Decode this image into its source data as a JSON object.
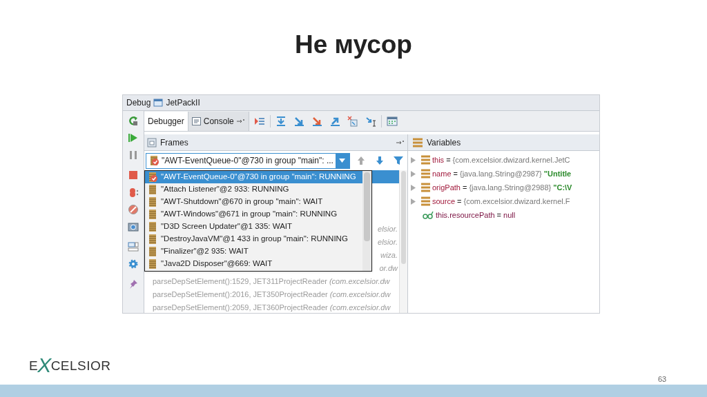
{
  "slide": {
    "title": "Не мусор",
    "logo": "EXCELSIOR",
    "page_number": "63"
  },
  "window": {
    "title": "Debug",
    "config": "JetPackII"
  },
  "tabs": [
    {
      "label": "Debugger",
      "selected": true
    },
    {
      "label": "Console",
      "selected": false
    }
  ],
  "frames": {
    "title": "Frames",
    "thread_selector": {
      "value": "\"AWT-EventQueue-0\"@730 in group \"main\": ..."
    },
    "thread_list": [
      {
        "label": "\"AWT-EventQueue-0\"@730 in group \"main\": RUNNING",
        "selected": true,
        "kind": "current"
      },
      {
        "label": "\"Attach Listener\"@2 933: RUNNING",
        "selected": false,
        "kind": "thread"
      },
      {
        "label": "\"AWT-Shutdown\"@670 in group \"main\": WAIT",
        "selected": false,
        "kind": "thread"
      },
      {
        "label": "\"AWT-Windows\"@671 in group \"main\": RUNNING",
        "selected": false,
        "kind": "thread"
      },
      {
        "label": "\"D3D Screen Updater\"@1 335: WAIT",
        "selected": false,
        "kind": "thread"
      },
      {
        "label": "\"DestroyJavaVM\"@1 433 in group \"main\": RUNNING",
        "selected": false,
        "kind": "thread"
      },
      {
        "label": "\"Finalizer\"@2 935: WAIT",
        "selected": false,
        "kind": "thread"
      },
      {
        "label": "\"Java2D Disposer\"@669: WAIT",
        "selected": false,
        "kind": "thread"
      }
    ],
    "stack_rows": [
      {
        "selected": true
      },
      {
        "selected": false
      },
      {
        "selected": false
      },
      {
        "selected": false
      },
      {
        "selected": false,
        "kind": "fragment",
        "text": "elsior."
      },
      {
        "selected": false,
        "kind": "fragment",
        "text": "elsior."
      },
      {
        "selected": false,
        "kind": "fragment",
        "text": "wiza."
      },
      {
        "selected": false,
        "kind": "fragment",
        "text": "or.dw"
      },
      {
        "selected": false,
        "kind": "frame",
        "method": "parseDepSetElement():1529, JET311ProjectReader",
        "package": "(com.excelsior.dw"
      },
      {
        "selected": false,
        "kind": "frame",
        "method": "parseDepSetElement():2016, JET350ProjectReader",
        "package": "(com.excelsior.dw"
      },
      {
        "selected": false,
        "kind": "frame",
        "method": "parseDepSetElement():2059, JET360ProjectReader",
        "package": "(com.excelsior.dw"
      }
    ]
  },
  "variables": {
    "title": "Variables",
    "rows": [
      {
        "kind": "field",
        "name": "this",
        "operator": "=",
        "value": "{com.excelsior.dwizard.kernel.JetC"
      },
      {
        "kind": "field",
        "name": "name",
        "operator": "=",
        "value": "{java.lang.String@2987}",
        "string": "\"Untitle"
      },
      {
        "kind": "field",
        "name": "origPath",
        "operator": "=",
        "value": "{java.lang.String@2988}",
        "string": "\"C:\\V"
      },
      {
        "kind": "field",
        "name": "source",
        "operator": "=",
        "value": "{com.excelsior.dwizard.kernel.F"
      },
      {
        "kind": "watch",
        "name": "this.resourcePath",
        "operator": "=",
        "value": "null"
      }
    ]
  }
}
